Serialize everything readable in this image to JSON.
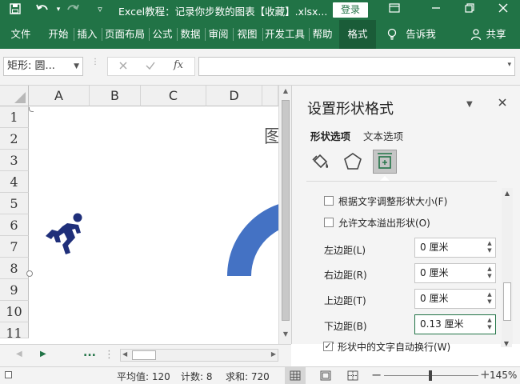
{
  "titlebar": {
    "title": "Excel教程：记录你步数的图表【收藏】.xlsx...",
    "login": "登录",
    "icons": [
      "save-icon",
      "undo-icon",
      "redo-icon",
      "customize-icon",
      "ribbon-display-icon",
      "minimize-icon",
      "restore-icon",
      "close-icon"
    ]
  },
  "ribbon": {
    "tabs": [
      "文件",
      "开始",
      "插入",
      "页面布局",
      "公式",
      "数据",
      "审阅",
      "视图",
      "开发工具",
      "帮助",
      "格式"
    ],
    "tellme": "告诉我",
    "share": "共享"
  },
  "formula_bar": {
    "name_box": "矩形: 圆...",
    "fx": "fx",
    "value": ""
  },
  "grid": {
    "columns": [
      "A",
      "B",
      "C",
      "D"
    ],
    "rows": [
      "1",
      "2",
      "3",
      "4",
      "5",
      "6",
      "7",
      "8",
      "9",
      "10",
      "11"
    ],
    "partial_text": "图"
  },
  "panel": {
    "title": "设置形状格式",
    "tabs": [
      "形状选项",
      "文本选项"
    ],
    "checkboxes": [
      {
        "label": "根据文字调整形状大小(F)",
        "checked": false
      },
      {
        "label": "允许文本溢出形状(O)",
        "checked": false
      },
      {
        "label": "形状中的文字自动换行(W)",
        "checked": true
      }
    ],
    "margins": [
      {
        "label": "左边距(L)",
        "value": "0 厘米"
      },
      {
        "label": "右边距(R)",
        "value": "0 厘米"
      },
      {
        "label": "上边距(T)",
        "value": "0 厘米"
      },
      {
        "label": "下边距(B)",
        "value": "0.13 厘米"
      }
    ]
  },
  "sheetbar": {
    "dots": "..."
  },
  "status": {
    "average": "平均值: 120",
    "count": "计数: 8",
    "sum": "求和: 720",
    "zoom": "145%"
  },
  "colors": {
    "excel_green": "#217346",
    "shape_blue": "#4472C4",
    "runner_navy": "#1f2f7a"
  }
}
